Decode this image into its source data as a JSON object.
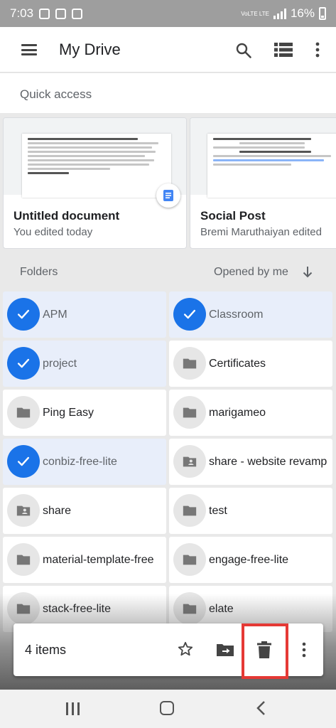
{
  "status_bar": {
    "time": "7:03",
    "network": "VoLTE LTE",
    "battery": "16%"
  },
  "app_bar": {
    "title": "My Drive"
  },
  "quick_access": {
    "label": "Quick access",
    "cards": [
      {
        "name": "Untitled document",
        "subtitle": "You edited today"
      },
      {
        "name": "Social Post",
        "subtitle": "Bremi Maruthaiyan edited"
      }
    ]
  },
  "folders_header": {
    "label": "Folders",
    "sort_label": "Opened by me"
  },
  "folders": [
    {
      "name": "APM",
      "selected": true
    },
    {
      "name": "Classroom",
      "selected": true
    },
    {
      "name": "project",
      "selected": true
    },
    {
      "name": "Certificates",
      "selected": false
    },
    {
      "name": "Ping Easy",
      "selected": false
    },
    {
      "name": "marigameo",
      "selected": false
    },
    {
      "name": "conbiz-free-lite",
      "selected": true
    },
    {
      "name": "share - website revamp",
      "selected": false,
      "shared": true
    },
    {
      "name": "share",
      "selected": false,
      "shared": true
    },
    {
      "name": "test",
      "selected": false
    },
    {
      "name": "material-template-free",
      "selected": false
    },
    {
      "name": "engage-free-lite",
      "selected": false
    },
    {
      "name": "stack-free-lite",
      "selected": false
    },
    {
      "name": "elate",
      "selected": false
    }
  ],
  "selection_bar": {
    "count_label": "4 items"
  },
  "icons": {
    "menu": "menu-icon",
    "search": "search-icon",
    "view": "list-view-icon",
    "more": "more-vert-icon",
    "star": "star-icon",
    "move": "move-to-folder-icon",
    "trash": "trash-icon"
  },
  "colors": {
    "accent": "#1a73e8",
    "selected_bg": "#e8eefa",
    "highlight": "#e53935"
  }
}
